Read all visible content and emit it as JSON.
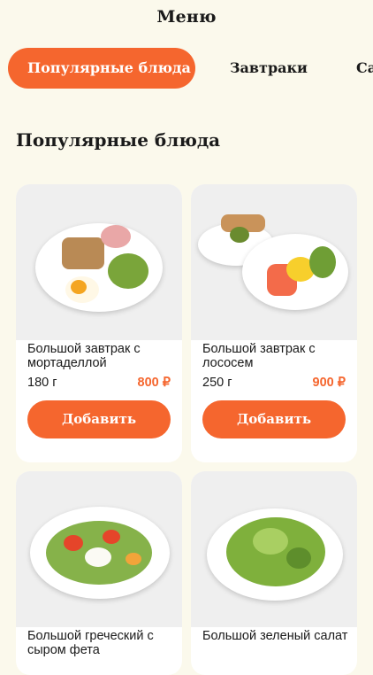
{
  "header": {
    "title": "Меню"
  },
  "tabs": [
    {
      "label": "Популярные блюда",
      "active": true
    },
    {
      "label": "Завтраки",
      "active": false
    },
    {
      "label": "Са",
      "active": false
    }
  ],
  "section": {
    "title": "Популярные блюда"
  },
  "products": [
    {
      "name": "Большой завтрак с мортаделлой",
      "weight": "180 г",
      "price": "800 ₽",
      "button": "Добавить"
    },
    {
      "name": "Большой завтрак с лососем",
      "weight": "250 г",
      "price": "900 ₽",
      "button": "Добавить"
    },
    {
      "name": "Большой греческий с сыром фета",
      "weight": "",
      "price": "",
      "button": ""
    },
    {
      "name": "Большой зеленый салат",
      "weight": "",
      "price": "",
      "button": ""
    }
  ],
  "colors": {
    "accent": "#f5662e",
    "background": "#fbf9ec",
    "card": "#ffffff"
  }
}
